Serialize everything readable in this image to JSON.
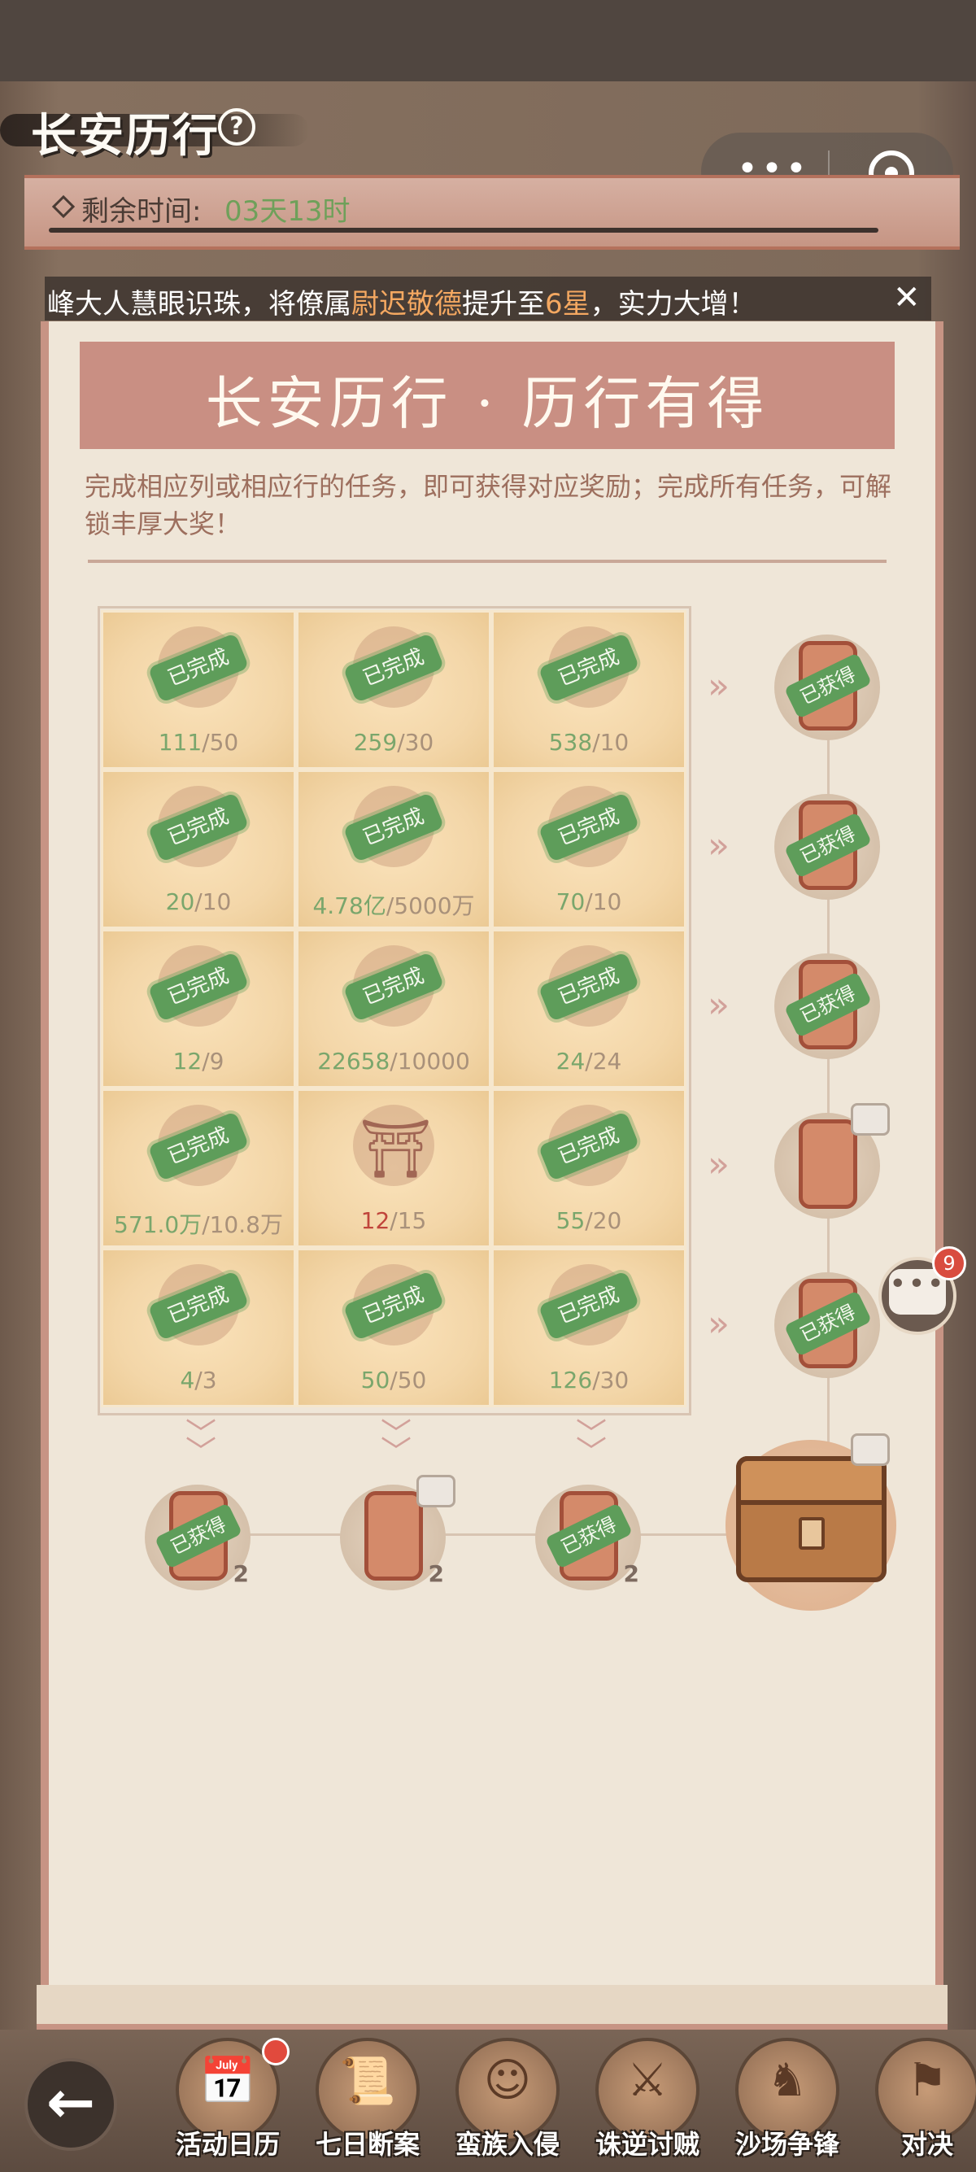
{
  "header": {
    "title": "长安历行",
    "help": "?"
  },
  "capsule": {
    "more": "•••"
  },
  "timer": {
    "label": "剩余时间:",
    "value": "03天13时"
  },
  "notice": {
    "pre": "峰大人慧眼识珠，将僚属",
    "name": "尉迟敬德",
    "mid": "提升至",
    "star": "6星",
    "post": "，实力大增！",
    "close": "✕"
  },
  "section": {
    "title": "长安历行 · 历行有得",
    "description": "完成相应列或相应行的任务，即可获得对应奖励；完成所有任务，可解锁丰厚大奖！"
  },
  "grid": {
    "stamp_label": "已完成",
    "rows": [
      [
        {
          "current": "111",
          "target": "50",
          "done": true
        },
        {
          "current": "259",
          "target": "30",
          "done": true
        },
        {
          "current": "538",
          "target": "10",
          "done": true
        }
      ],
      [
        {
          "current": "20",
          "target": "10",
          "done": true
        },
        {
          "current": "4.78亿",
          "target": "5000万",
          "done": true
        },
        {
          "current": "70",
          "target": "10",
          "done": true
        }
      ],
      [
        {
          "current": "12",
          "target": "9",
          "done": true
        },
        {
          "current": "22658",
          "target": "10000",
          "done": true
        },
        {
          "current": "24",
          "target": "24",
          "done": true
        }
      ],
      [
        {
          "current": "571.0万",
          "target": "10.8万",
          "done": true
        },
        {
          "current": "12",
          "target": "15",
          "done": false
        },
        {
          "current": "55",
          "target": "20",
          "done": true
        }
      ],
      [
        {
          "current": "4",
          "target": "3",
          "done": true
        },
        {
          "current": "50",
          "target": "50",
          "done": true
        },
        {
          "current": "126",
          "target": "30",
          "done": true
        }
      ]
    ]
  },
  "rewards": {
    "obtained_label": "已获得",
    "rows": [
      {
        "obtained": true
      },
      {
        "obtained": true
      },
      {
        "obtained": true
      },
      {
        "obtained": false
      },
      {
        "obtained": true
      }
    ],
    "columns": [
      {
        "obtained": true,
        "count": "2"
      },
      {
        "obtained": false,
        "count": "2"
      },
      {
        "obtained": true,
        "count": "2"
      }
    ]
  },
  "chat": {
    "count": "9",
    "dots": "•••"
  },
  "bottom_nav": {
    "back": "←",
    "items": [
      {
        "label": "活动日历",
        "icon": "calendar-icon",
        "glyph": "📅",
        "badge": true
      },
      {
        "label": "七日断案",
        "icon": "scroll-icon",
        "glyph": "📜",
        "badge": false
      },
      {
        "label": "蛮族入侵",
        "icon": "barbarian-icon",
        "glyph": "☺",
        "badge": false
      },
      {
        "label": "诛逆讨贼",
        "icon": "warrior-icon",
        "glyph": "⚔",
        "badge": false
      },
      {
        "label": "沙场争锋",
        "icon": "cavalry-icon",
        "glyph": "♞",
        "badge": false
      },
      {
        "label": "对决",
        "icon": "duel-icon",
        "glyph": "⚑",
        "badge": false
      }
    ]
  }
}
